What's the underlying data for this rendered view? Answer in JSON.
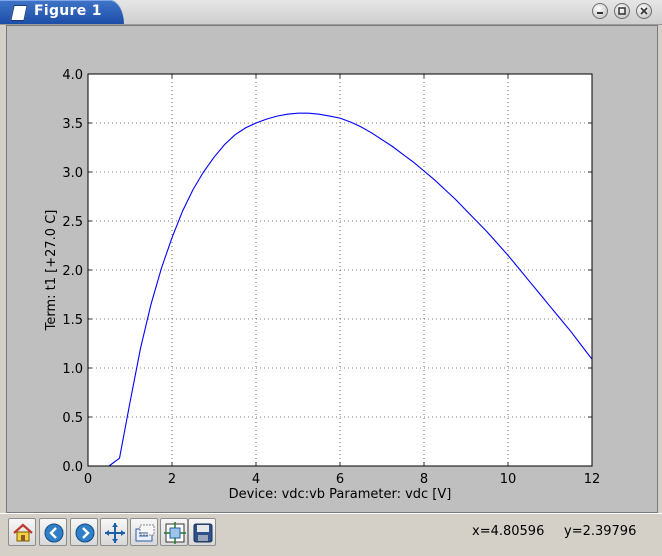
{
  "window": {
    "title": "Figure 1"
  },
  "window_controls": [
    "minimize-icon",
    "maximize-icon",
    "close-icon"
  ],
  "toolbar": {
    "buttons": [
      {
        "name": "home-button",
        "icon": "home-icon"
      },
      {
        "name": "back-button",
        "icon": "arrow-left-icon"
      },
      {
        "name": "forward-button",
        "icon": "arrow-right-icon"
      },
      {
        "name": "pan-button",
        "icon": "move-icon"
      },
      {
        "name": "zoom-button",
        "icon": "zoom-rect-icon"
      },
      {
        "name": "subplots-button",
        "icon": "subplots-icon"
      },
      {
        "name": "save-button",
        "icon": "floppy-icon"
      }
    ],
    "x_readout": "x=4.80596",
    "y_readout": "y=2.39796"
  },
  "colors": {
    "line": "#0000ff",
    "figure_bg": "#bfbfbf",
    "axes_bg": "#ffffff",
    "title_bar": "#2a5bb5"
  },
  "chart_data": {
    "type": "line",
    "xlabel": "Device: vdc:vb  Parameter: vdc [V]",
    "ylabel": "Term: t1 [+27.0 C]",
    "xlim": [
      0,
      12
    ],
    "ylim": [
      0,
      4
    ],
    "xticks": [
      "0",
      "2",
      "4",
      "6",
      "8",
      "10",
      "12"
    ],
    "yticks": [
      "0.0",
      "0.5",
      "1.0",
      "1.5",
      "2.0",
      "2.5",
      "3.0",
      "3.5",
      "4.0"
    ],
    "grid": true,
    "series": [
      {
        "x": [
          0.5,
          0.75,
          1.0,
          1.25,
          1.5,
          1.75,
          2.0,
          2.25,
          2.5,
          2.75,
          3.0,
          3.25,
          3.5,
          3.75,
          4.0,
          4.25,
          4.5,
          4.75,
          5.0,
          5.25,
          5.5,
          5.75,
          6.0,
          6.25,
          6.5,
          6.75,
          7.0,
          7.25,
          7.5,
          7.75,
          8.0,
          8.25,
          8.5,
          8.75,
          9.0,
          9.25,
          9.5,
          9.75,
          10.0,
          10.25,
          10.5,
          10.75,
          11.0,
          11.25,
          11.5,
          11.75,
          12.0
        ],
        "y": [
          0.0,
          0.08,
          0.65,
          1.2,
          1.65,
          2.02,
          2.33,
          2.6,
          2.82,
          3.0,
          3.15,
          3.28,
          3.38,
          3.45,
          3.5,
          3.54,
          3.57,
          3.59,
          3.6,
          3.6,
          3.59,
          3.57,
          3.55,
          3.51,
          3.46,
          3.4,
          3.33,
          3.26,
          3.18,
          3.1,
          3.01,
          2.92,
          2.82,
          2.72,
          2.61,
          2.5,
          2.39,
          2.27,
          2.15,
          2.02,
          1.89,
          1.76,
          1.63,
          1.5,
          1.37,
          1.23,
          1.09
        ]
      }
    ]
  }
}
